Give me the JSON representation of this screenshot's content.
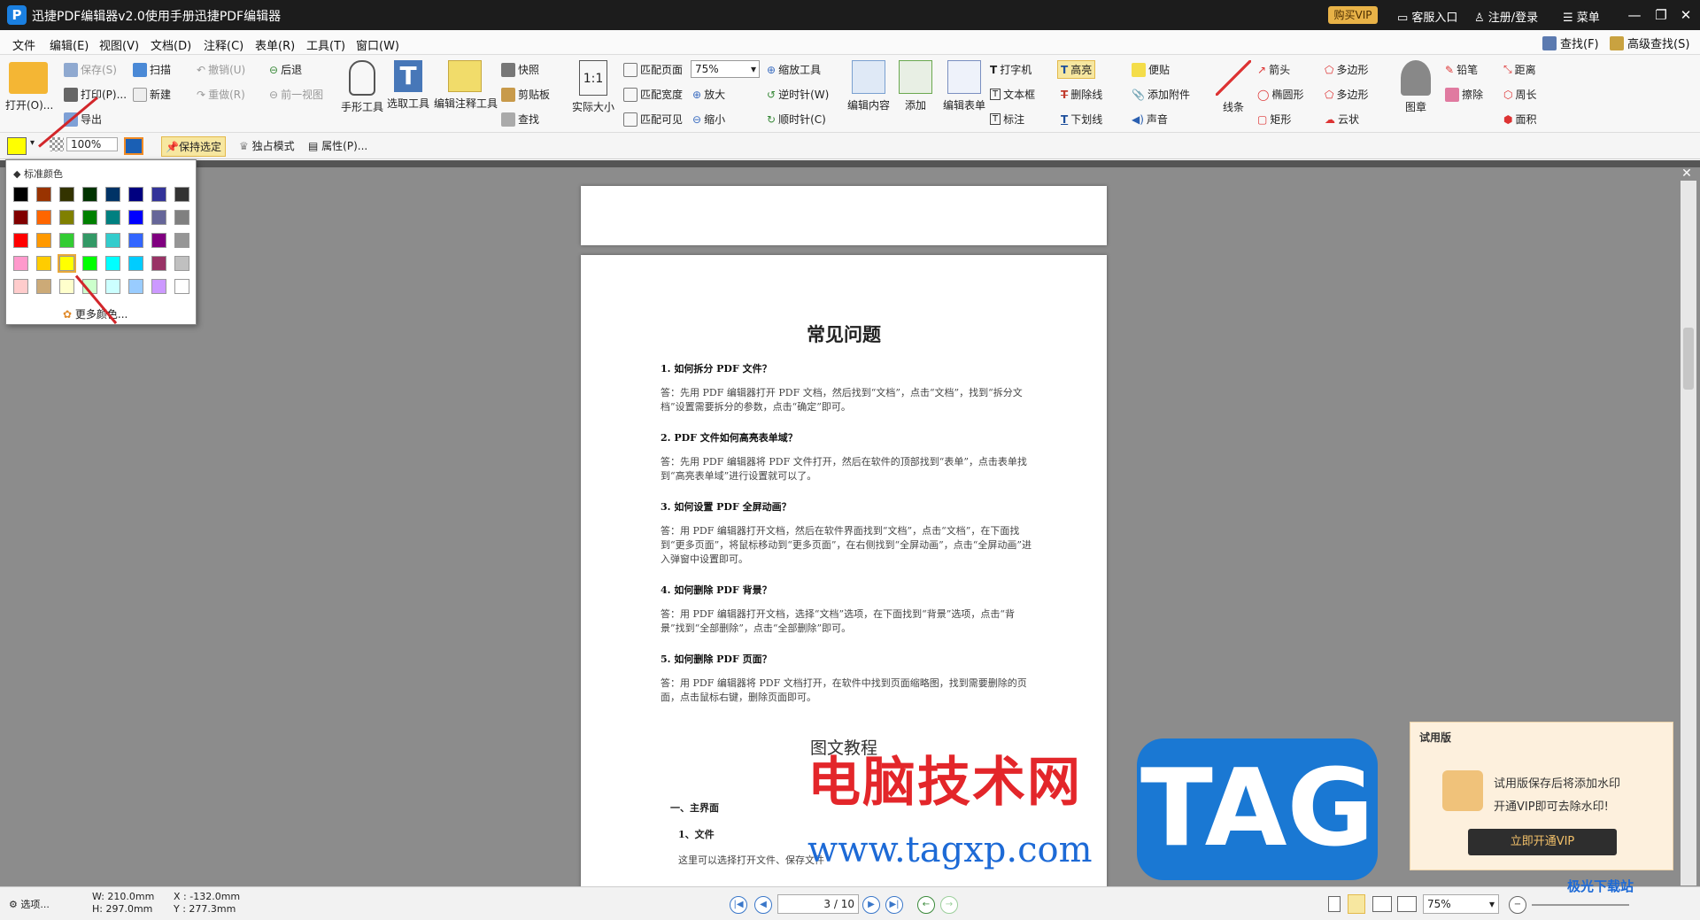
{
  "titlebar": {
    "title": "迅捷PDF编辑器v2.0使用手册迅捷PDF编辑器",
    "vip": "购买VIP",
    "service": "客服入口",
    "login": "注册/登录",
    "menu": "菜单"
  },
  "menus": [
    "文件",
    "编辑(E)",
    "视图(V)",
    "文档(D)",
    "注释(C)",
    "表单(R)",
    "工具(T)",
    "窗口(W)"
  ],
  "top_tools": {
    "find": "查找(F)",
    "adv_find": "高级查找(S)"
  },
  "ribbon": {
    "open": "打开(O)...",
    "save": "保存(S)",
    "print": "打印(P)...",
    "export": "导出",
    "scan": "扫描",
    "new": "新建",
    "undo": "撤销(U)",
    "redo": "重做(R)",
    "back": "后退",
    "prev_view": "前一视图",
    "hand": "手形工具",
    "select": "选取工具",
    "edit_annot": "编辑注释工具",
    "snapshot": "快照",
    "clipboard": "剪贴板",
    "search": "查找",
    "actual": "实际大小",
    "fit_page": "匹配页面",
    "fit_width": "匹配宽度",
    "fit_visible": "匹配可见",
    "zoom_value": "75%",
    "zoom_in": "放大",
    "zoom_out": "缩小",
    "zoom_tool": "缩放工具",
    "ccw": "逆时针(W)",
    "cw": "顺时针(C)",
    "edit_content": "编辑内容",
    "add": "添加",
    "edit_form": "编辑表单",
    "typewriter": "打字机",
    "textbox": "文本框",
    "callout": "标注",
    "highlight": "高亮",
    "strikeout": "删除线",
    "underline": "下划线",
    "note": "便贴",
    "attach": "添加附件",
    "sound": "声音",
    "line": "线条",
    "arrow": "箭头",
    "ellipse": "椭圆形",
    "rect": "矩形",
    "polygon": "多边形",
    "polyline": "多边形",
    "cloud": "云状",
    "stamp": "图章",
    "pencil": "铅笔",
    "eraser": "擦除",
    "distance": "距离",
    "perimeter": "周长",
    "area": "面积"
  },
  "toolbar2": {
    "opacity": "100%",
    "keep": "保持选定",
    "exclusive": "独占模式",
    "props": "属性(P)..."
  },
  "color_popup": {
    "title": "标准颜色",
    "more": "更多颜色...",
    "swatches": [
      "#000000",
      "#993300",
      "#333300",
      "#003300",
      "#003366",
      "#000080",
      "#333399",
      "#333333",
      "#800000",
      "#ff6600",
      "#808000",
      "#008000",
      "#008080",
      "#0000ff",
      "#666699",
      "#808080",
      "#ff0000",
      "#ff9900",
      "#33cc33",
      "#339966",
      "#33cccc",
      "#3366ff",
      "#800080",
      "#969696",
      "#ff99cc",
      "#ffcc00",
      "#ffff00",
      "#00ff00",
      "#00ffff",
      "#00ccff",
      "#993366",
      "#c0c0c0",
      "#ffcccc",
      "#ccaa77",
      "#ffffcc",
      "#ccffcc",
      "#ccffff",
      "#99ccff",
      "#cc99ff",
      "#ffffff"
    ],
    "selected_index": 26
  },
  "document": {
    "title": "常见问题",
    "qa": [
      {
        "q": "1.  如何拆分 PDF 文件？",
        "a": "答：先用 PDF 编辑器打开 PDF 文档，然后找到“文档”，点击“文档”，找到“拆分文档”设置需要拆分的参数，点击“确定”即可。"
      },
      {
        "q": "2.  PDF 文件如何高亮表单域？",
        "a": "答：先用 PDF 编辑器将 PDF 文件打开，然后在软件的顶部找到“表单”，点击表单找到“高亮表单域”进行设置就可以了。"
      },
      {
        "q": "3.  如何设置 PDF 全屏动画？",
        "a": "答：用 PDF 编辑器打开文档，然后在软件界面找到“文档”，点击“文档”，在下面找到“更多页面”，将鼠标移动到“更多页面”，在右侧找到“全屏动画”，点击“全屏动画”进入弹窗中设置即可。"
      },
      {
        "q": "4.  如何删除 PDF 背景？",
        "a": "答：用 PDF 编辑器打开文档，选择“文档”选项，在下面找到“背景”选项，点击“背景”找到“全部删除”，点击“全部删除”即可。"
      },
      {
        "q": "5.  如何删除 PDF 页面？",
        "a": "答：用 PDF 编辑器将 PDF 文档打开，在软件中找到页面缩略图，找到需要删除的页面，点击鼠标右键，删除页面即可。"
      }
    ],
    "section": "图文教程",
    "sub1": "一、主界面",
    "sub2": "1、文件",
    "body": "这里可以选择打开文件、保存文件"
  },
  "statusbar": {
    "options": "选项...",
    "w": "W: 210.0mm",
    "h": "H: 297.0mm",
    "x": "X : -132.0mm",
    "y": "Y : 277.3mm",
    "page": "3 / 10",
    "zoom": "75%"
  },
  "trial": {
    "head": "试用版",
    "line1": "试用版保存后将添加水印",
    "line2": "开通VIP即可去除水印!",
    "button": "立即开通VIP"
  },
  "watermarks": {
    "cn": "电脑技术网",
    "url": "www.tagxp.com",
    "tag": "TAG",
    "jg": "极光下载站"
  }
}
